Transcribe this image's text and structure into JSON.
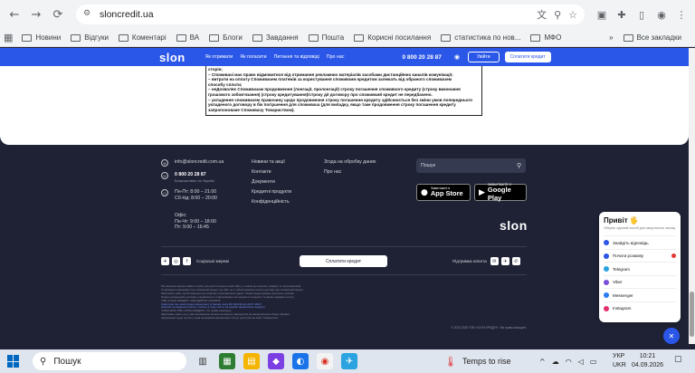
{
  "browser": {
    "url": "sloncredit.ua",
    "nav": {
      "back": "←",
      "forward": "→",
      "reload": "⟳"
    }
  },
  "bookmarks": {
    "items": [
      "Новини",
      "Відгуки",
      "Коментарі",
      "ВА",
      "Блоги",
      "Завдання",
      "Пошта",
      "Корисні посилання",
      "статистика по нов...",
      "МФО"
    ],
    "more": "»",
    "all": "Все закладки"
  },
  "header": {
    "logo": "slon",
    "nav": [
      "Як отримати",
      "Як погасити",
      "Питання та відповіді",
      "Про нас"
    ],
    "phone": "0 800 20 28 87",
    "login": "Увійти",
    "pay": "Сплатити кредит"
  },
  "terms": {
    "lines": [
      "сторін;",
      "– Споживачі має право відмовитися від отримання рекламних матеріалів засобами дистанційних каналів комунікації;",
      "– витрати на оплату Споживачем платежів за користування споживчим кредитом залежать від обраного споживачем",
      "способу сплати;",
      "– неДозволяє Споживачам продовження (лонгації, пролонгації) строку погашення споживчого кредиту (строку виконання",
      "грошового зобов'язання) (строку кредитування)/строку дії договору про споживчий кредит не передбачено.",
      "– укладення споживачем правочину щодо продовження строку погашення кредиту здійснюється без зміни умов попереднього",
      "укладеного договору в бік погіршення для споживача (для випадку, якщо таке продовження строку погашення кредиту",
      "запропоноване Споживачу Товариством)."
    ]
  },
  "footer": {
    "email": "info@sloncredit.com.ua",
    "phone": "0 800 20 28 87",
    "phone_note": "Безкоштовно по Україні",
    "hours1": "Пн-Пт: 8:00 – 21:00",
    "hours2": "Сб-Нд: 8:00 – 20:00",
    "office_label": "Офіс:",
    "office1": "Пн-Чт: 9:00 – 18:00",
    "office2": "Пт: 9:00 – 16:45",
    "links1": [
      "Новини та акції",
      "Контакти",
      "Документи",
      "Кредитні продукти",
      "Конфіденційність"
    ],
    "links2": [
      "Згода на обробку даних",
      "Про нас"
    ],
    "search_placeholder": "Пошук",
    "appstore_small": "Завантажте в",
    "appstore_big": "App Store",
    "gplay_small": "ЗАВАНТАЖТЕ З",
    "gplay_big": "Google Play",
    "logo": "slon",
    "social_label": "Соціальні мережі",
    "pay_button": "Сплатити кредит",
    "support_label": "Підтримка клієнта",
    "legal_lines": [
      "Ми використовуємо файли cookie для роботи нашого веб-сайту, а також для аналізу трафіку та персоналізації.",
      "Отримання інформації про споживчий кредит на сайті не є зобов'язанням укласти договір про споживчий кредит.",
      "Звертаємо увагу на Положення про обробку персональних даних. Умови кредитування детально описані.",
      "Перед укладенням договору ознайомтеся з інформацією про кредитні продукти та умови надання послуг.",
      "ТОВ «СЛОН КРЕДИТ» КОД ЄДРПОУ 43126376",
      "Свідоцтво про реєстрацію фінансової установи серія ФК №1430 від 22.07.2020",
      "Ліцензія на надання коштів у позику, в тому числі і на умовах фінансового кредиту.",
      "©2020-2026 ТОВ «СЛОН КРЕДИТ». Усі права захищено.",
      "Звертаємо увагу, що у разі виникнення питань ви можете звернутися до Національного банку України.",
      "Інформація щодо захисту прав споживачів фінансових послуг доступна на сайті Товариства."
    ],
    "copyright": "© 2020-2026 ТОВ «СЛОН КРЕДИТ». Всі права захищені."
  },
  "chat": {
    "title": "Привіт 🖐",
    "subtitle": "Оберіть зручний спосіб для зворотнього зв'язку",
    "items": [
      {
        "label": "Знайдіть відповідь",
        "color": "#2b57e8"
      },
      {
        "label": "Почати розмову",
        "color": "#2b57e8"
      },
      {
        "label": "Telegram",
        "color": "#2aa3e0"
      },
      {
        "label": "Viber",
        "color": "#7a4fd8"
      },
      {
        "label": "Messenger",
        "color": "#2b7cf2"
      },
      {
        "label": "Instagram",
        "color": "#e1306c"
      }
    ]
  },
  "taskbar": {
    "search": "Пошук",
    "weather": "Temps to rise",
    "lang1": "УКР",
    "lang2": "UKR",
    "time": "10:21",
    "date": "04.09.2026"
  }
}
